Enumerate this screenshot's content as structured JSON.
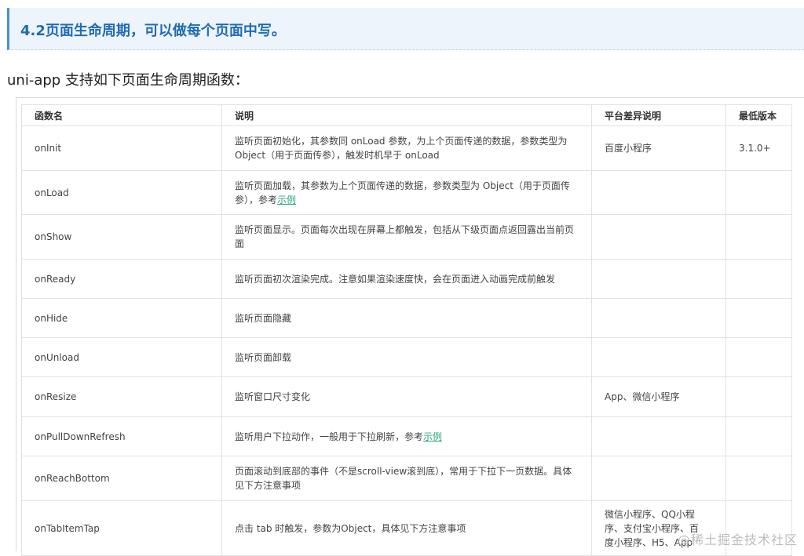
{
  "heading": "4.2页面生命周期，可以做每个页面中写。",
  "intro": "uni-app 支持如下页面生命周期函数：",
  "table": {
    "headers": [
      "函数名",
      "说明",
      "平台差异说明",
      "最低版本"
    ],
    "rows": [
      {
        "name": "onInit",
        "desc": "监听页面初始化，其参数同 onLoad 参数，为上个页面传递的数据，参数类型为 Object（用于页面传参），触发时机早于 onLoad",
        "platform": "百度小程序",
        "version": "3.1.0+"
      },
      {
        "name": "onLoad",
        "desc": "监听页面加载，其参数为上个页面传递的数据，参数类型为 Object（用于页面传参），参考",
        "link": "示例",
        "platform": "",
        "version": ""
      },
      {
        "name": "onShow",
        "desc": "监听页面显示。页面每次出现在屏幕上都触发，包括从下级页面点返回露出当前页面",
        "platform": "",
        "version": ""
      },
      {
        "name": "onReady",
        "desc": "监听页面初次渲染完成。注意如果渲染速度快，会在页面进入动画完成前触发",
        "platform": "",
        "version": ""
      },
      {
        "name": "onHide",
        "desc": "监听页面隐藏",
        "platform": "",
        "version": ""
      },
      {
        "name": "onUnload",
        "desc": "监听页面卸载",
        "platform": "",
        "version": ""
      },
      {
        "name": "onResize",
        "desc": "监听窗口尺寸变化",
        "platform": "App、微信小程序",
        "version": ""
      },
      {
        "name": "onPullDownRefresh",
        "desc": "监听用户下拉动作，一般用于下拉刷新，参考",
        "link": "示例",
        "platform": "",
        "version": ""
      },
      {
        "name": "onReachBottom",
        "desc": "页面滚动到底部的事件（不是scroll-view滚到底），常用于下拉下一页数据。具体见下方注意事项",
        "platform": "",
        "version": ""
      },
      {
        "name": "onTabItemTap",
        "desc": "点击 tab 时触发，参数为Object，具体见下方注意事项",
        "platform": "微信小程序、QQ小程序、支付宝小程序、百度小程序、H5、App",
        "version": ""
      }
    ]
  },
  "watermark": "@稀土掘金技术社区"
}
